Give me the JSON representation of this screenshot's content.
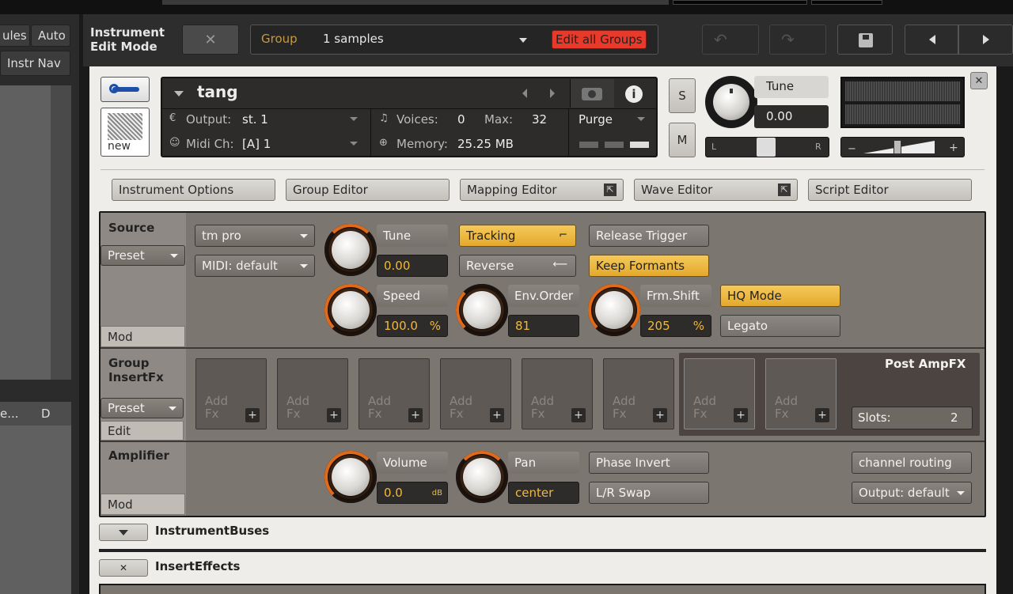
{
  "left_panel": {
    "tab1": "ules",
    "tab2": "Auto",
    "instr_nav": "Instr Nav",
    "col1": "e...",
    "col2": "D"
  },
  "header": {
    "title_line1": "Instrument",
    "title_line2": "Edit Mode",
    "close": "✕",
    "group_label": "Group",
    "samples": "1 samples",
    "edit_all": "Edit all Groups"
  },
  "rack": {
    "name": "tang",
    "output_label": "Output:",
    "output_value": "st. 1",
    "midi_label": "Midi Ch:",
    "midi_value": "[A]  1",
    "voices_label": "Voices:",
    "voices_value": "0",
    "max_label": "Max:",
    "max_value": "32",
    "memory_label": "Memory:",
    "memory_value": "25.25 MB",
    "purge": "Purge",
    "new_label": "new",
    "s": "S",
    "m": "M",
    "tune_label": "Tune",
    "tune_value": "0.00",
    "pan_l": "L",
    "pan_r": "R",
    "close": "✕"
  },
  "editor_tabs": [
    "Instrument Options",
    "Group Editor",
    "Mapping Editor",
    "Wave Editor",
    "Script Editor"
  ],
  "source": {
    "title": "Source",
    "preset": "Preset",
    "mod": "Mod",
    "engine": "tm pro",
    "midi": "MIDI: default",
    "tune_label": "Tune",
    "tune_value": "0.00",
    "speed_label": "Speed",
    "speed_value": "100.0",
    "speed_unit": "%",
    "envorder_label": "Env.Order",
    "envorder_value": "81",
    "frmshift_label": "Frm.Shift",
    "frmshift_value": "205",
    "frmshift_unit": "%",
    "tracking": "Tracking",
    "reverse": "Reverse",
    "release_trigger": "Release Trigger",
    "keep_formants": "Keep Formants",
    "hq_mode": "HQ Mode",
    "legato": "Legato"
  },
  "group_fx": {
    "title_line1": "Group",
    "title_line2": "InsertFx",
    "preset": "Preset",
    "edit": "Edit",
    "slot_line1": "Add",
    "slot_line2": "Fx",
    "plus": "+",
    "post_title": "Post AmpFX",
    "slots_label": "Slots:",
    "slots_value": "2"
  },
  "amplifier": {
    "title": "Amplifier",
    "mod": "Mod",
    "volume_label": "Volume",
    "volume_value": "0.0",
    "volume_unit": "dB",
    "pan_label": "Pan",
    "pan_value": "center",
    "phase_invert": "Phase Invert",
    "lr_swap": "L/R Swap",
    "channel_routing": "channel routing",
    "output": "Output: default"
  },
  "bottom": {
    "buses": "InstrumentBuses",
    "insert_effects": "InsertEffects",
    "x": "✕"
  },
  "colors": {
    "accent": "#f1b93c",
    "edit_all_bg": "#e8392a",
    "panel": "#7c7671"
  }
}
